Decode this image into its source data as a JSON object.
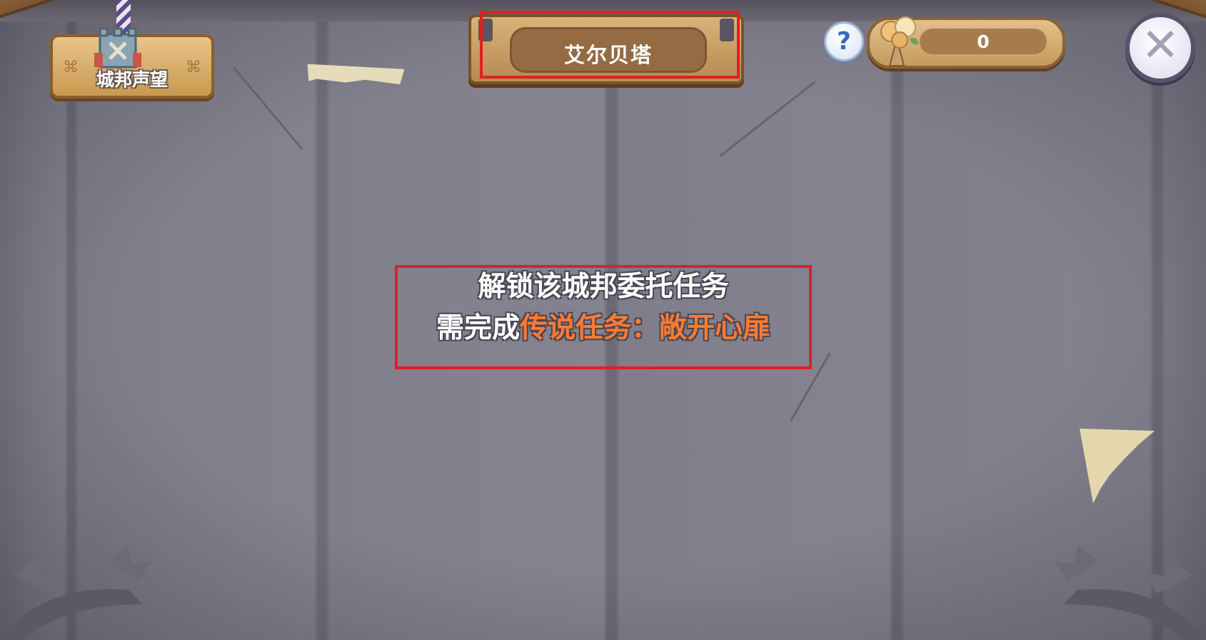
{
  "city_reputation": {
    "label": "城邦声望"
  },
  "title": {
    "text": "艾尔贝塔"
  },
  "top_bar": {
    "help_glyph": "?",
    "currency_value": "0",
    "close_glyph": "✕"
  },
  "notice": {
    "line1": "解锁该城邦委托任务",
    "line2_prefix": "需完成",
    "line2_highlight": "传说任务：敞开心扉",
    "highlight_color": "#ff7a33"
  },
  "icons": {
    "city_reputation": "castle-icon",
    "help": "question-icon",
    "currency": "flower-bouquet-icon",
    "close": "close-icon"
  },
  "annotations": {
    "color": "#e02020"
  }
}
